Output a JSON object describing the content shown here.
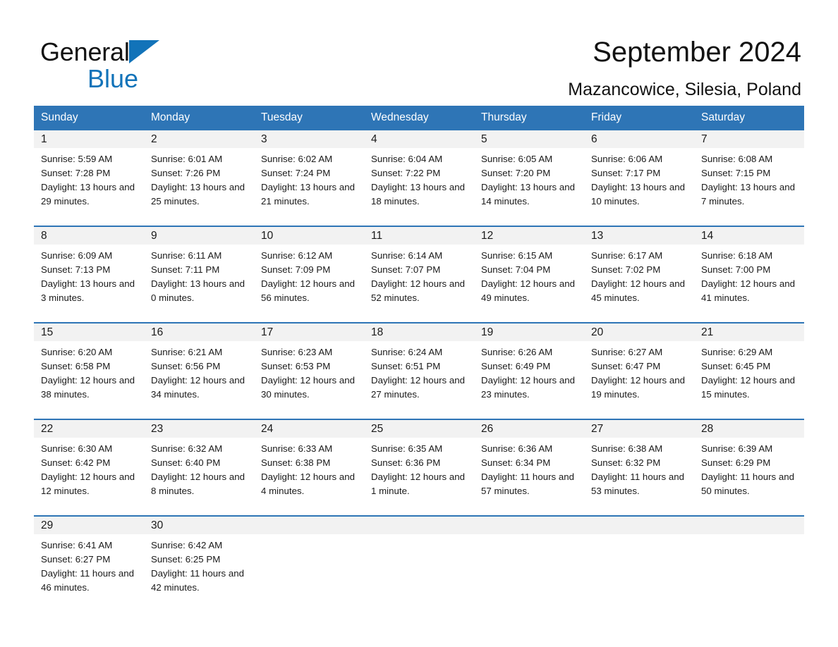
{
  "brand": {
    "name_part1": "General",
    "name_part2": "Blue",
    "triangle_color": "#1273b9"
  },
  "header": {
    "title": "September 2024",
    "subtitle": "Mazancowice, Silesia, Poland"
  },
  "theme": {
    "header_blue": "#2e75b6",
    "daynum_band": "#f2f2f2",
    "text": "#1a1a1a",
    "white": "#ffffff"
  },
  "weekday_headers": [
    "Sunday",
    "Monday",
    "Tuesday",
    "Wednesday",
    "Thursday",
    "Friday",
    "Saturday"
  ],
  "labels": {
    "sunrise_prefix": "Sunrise:",
    "sunset_prefix": "Sunset:",
    "daylight_prefix": "Daylight:"
  },
  "weeks": [
    {
      "days": [
        {
          "num": "1",
          "sunrise": "Sunrise: 5:59 AM",
          "sunset": "Sunset: 7:28 PM",
          "daylight": "Daylight: 13 hours and 29 minutes."
        },
        {
          "num": "2",
          "sunrise": "Sunrise: 6:01 AM",
          "sunset": "Sunset: 7:26 PM",
          "daylight": "Daylight: 13 hours and 25 minutes."
        },
        {
          "num": "3",
          "sunrise": "Sunrise: 6:02 AM",
          "sunset": "Sunset: 7:24 PM",
          "daylight": "Daylight: 13 hours and 21 minutes."
        },
        {
          "num": "4",
          "sunrise": "Sunrise: 6:04 AM",
          "sunset": "Sunset: 7:22 PM",
          "daylight": "Daylight: 13 hours and 18 minutes."
        },
        {
          "num": "5",
          "sunrise": "Sunrise: 6:05 AM",
          "sunset": "Sunset: 7:20 PM",
          "daylight": "Daylight: 13 hours and 14 minutes."
        },
        {
          "num": "6",
          "sunrise": "Sunrise: 6:06 AM",
          "sunset": "Sunset: 7:17 PM",
          "daylight": "Daylight: 13 hours and 10 minutes."
        },
        {
          "num": "7",
          "sunrise": "Sunrise: 6:08 AM",
          "sunset": "Sunset: 7:15 PM",
          "daylight": "Daylight: 13 hours and 7 minutes."
        }
      ]
    },
    {
      "days": [
        {
          "num": "8",
          "sunrise": "Sunrise: 6:09 AM",
          "sunset": "Sunset: 7:13 PM",
          "daylight": "Daylight: 13 hours and 3 minutes."
        },
        {
          "num": "9",
          "sunrise": "Sunrise: 6:11 AM",
          "sunset": "Sunset: 7:11 PM",
          "daylight": "Daylight: 13 hours and 0 minutes."
        },
        {
          "num": "10",
          "sunrise": "Sunrise: 6:12 AM",
          "sunset": "Sunset: 7:09 PM",
          "daylight": "Daylight: 12 hours and 56 minutes."
        },
        {
          "num": "11",
          "sunrise": "Sunrise: 6:14 AM",
          "sunset": "Sunset: 7:07 PM",
          "daylight": "Daylight: 12 hours and 52 minutes."
        },
        {
          "num": "12",
          "sunrise": "Sunrise: 6:15 AM",
          "sunset": "Sunset: 7:04 PM",
          "daylight": "Daylight: 12 hours and 49 minutes."
        },
        {
          "num": "13",
          "sunrise": "Sunrise: 6:17 AM",
          "sunset": "Sunset: 7:02 PM",
          "daylight": "Daylight: 12 hours and 45 minutes."
        },
        {
          "num": "14",
          "sunrise": "Sunrise: 6:18 AM",
          "sunset": "Sunset: 7:00 PM",
          "daylight": "Daylight: 12 hours and 41 minutes."
        }
      ]
    },
    {
      "days": [
        {
          "num": "15",
          "sunrise": "Sunrise: 6:20 AM",
          "sunset": "Sunset: 6:58 PM",
          "daylight": "Daylight: 12 hours and 38 minutes."
        },
        {
          "num": "16",
          "sunrise": "Sunrise: 6:21 AM",
          "sunset": "Sunset: 6:56 PM",
          "daylight": "Daylight: 12 hours and 34 minutes."
        },
        {
          "num": "17",
          "sunrise": "Sunrise: 6:23 AM",
          "sunset": "Sunset: 6:53 PM",
          "daylight": "Daylight: 12 hours and 30 minutes."
        },
        {
          "num": "18",
          "sunrise": "Sunrise: 6:24 AM",
          "sunset": "Sunset: 6:51 PM",
          "daylight": "Daylight: 12 hours and 27 minutes."
        },
        {
          "num": "19",
          "sunrise": "Sunrise: 6:26 AM",
          "sunset": "Sunset: 6:49 PM",
          "daylight": "Daylight: 12 hours and 23 minutes."
        },
        {
          "num": "20",
          "sunrise": "Sunrise: 6:27 AM",
          "sunset": "Sunset: 6:47 PM",
          "daylight": "Daylight: 12 hours and 19 minutes."
        },
        {
          "num": "21",
          "sunrise": "Sunrise: 6:29 AM",
          "sunset": "Sunset: 6:45 PM",
          "daylight": "Daylight: 12 hours and 15 minutes."
        }
      ]
    },
    {
      "days": [
        {
          "num": "22",
          "sunrise": "Sunrise: 6:30 AM",
          "sunset": "Sunset: 6:42 PM",
          "daylight": "Daylight: 12 hours and 12 minutes."
        },
        {
          "num": "23",
          "sunrise": "Sunrise: 6:32 AM",
          "sunset": "Sunset: 6:40 PM",
          "daylight": "Daylight: 12 hours and 8 minutes."
        },
        {
          "num": "24",
          "sunrise": "Sunrise: 6:33 AM",
          "sunset": "Sunset: 6:38 PM",
          "daylight": "Daylight: 12 hours and 4 minutes."
        },
        {
          "num": "25",
          "sunrise": "Sunrise: 6:35 AM",
          "sunset": "Sunset: 6:36 PM",
          "daylight": "Daylight: 12 hours and 1 minute."
        },
        {
          "num": "26",
          "sunrise": "Sunrise: 6:36 AM",
          "sunset": "Sunset: 6:34 PM",
          "daylight": "Daylight: 11 hours and 57 minutes."
        },
        {
          "num": "27",
          "sunrise": "Sunrise: 6:38 AM",
          "sunset": "Sunset: 6:32 PM",
          "daylight": "Daylight: 11 hours and 53 minutes."
        },
        {
          "num": "28",
          "sunrise": "Sunrise: 6:39 AM",
          "sunset": "Sunset: 6:29 PM",
          "daylight": "Daylight: 11 hours and 50 minutes."
        }
      ]
    },
    {
      "days": [
        {
          "num": "29",
          "sunrise": "Sunrise: 6:41 AM",
          "sunset": "Sunset: 6:27 PM",
          "daylight": "Daylight: 11 hours and 46 minutes."
        },
        {
          "num": "30",
          "sunrise": "Sunrise: 6:42 AM",
          "sunset": "Sunset: 6:25 PM",
          "daylight": "Daylight: 11 hours and 42 minutes."
        },
        {
          "num": "",
          "sunrise": "",
          "sunset": "",
          "daylight": ""
        },
        {
          "num": "",
          "sunrise": "",
          "sunset": "",
          "daylight": ""
        },
        {
          "num": "",
          "sunrise": "",
          "sunset": "",
          "daylight": ""
        },
        {
          "num": "",
          "sunrise": "",
          "sunset": "",
          "daylight": ""
        },
        {
          "num": "",
          "sunrise": "",
          "sunset": "",
          "daylight": ""
        }
      ]
    }
  ]
}
